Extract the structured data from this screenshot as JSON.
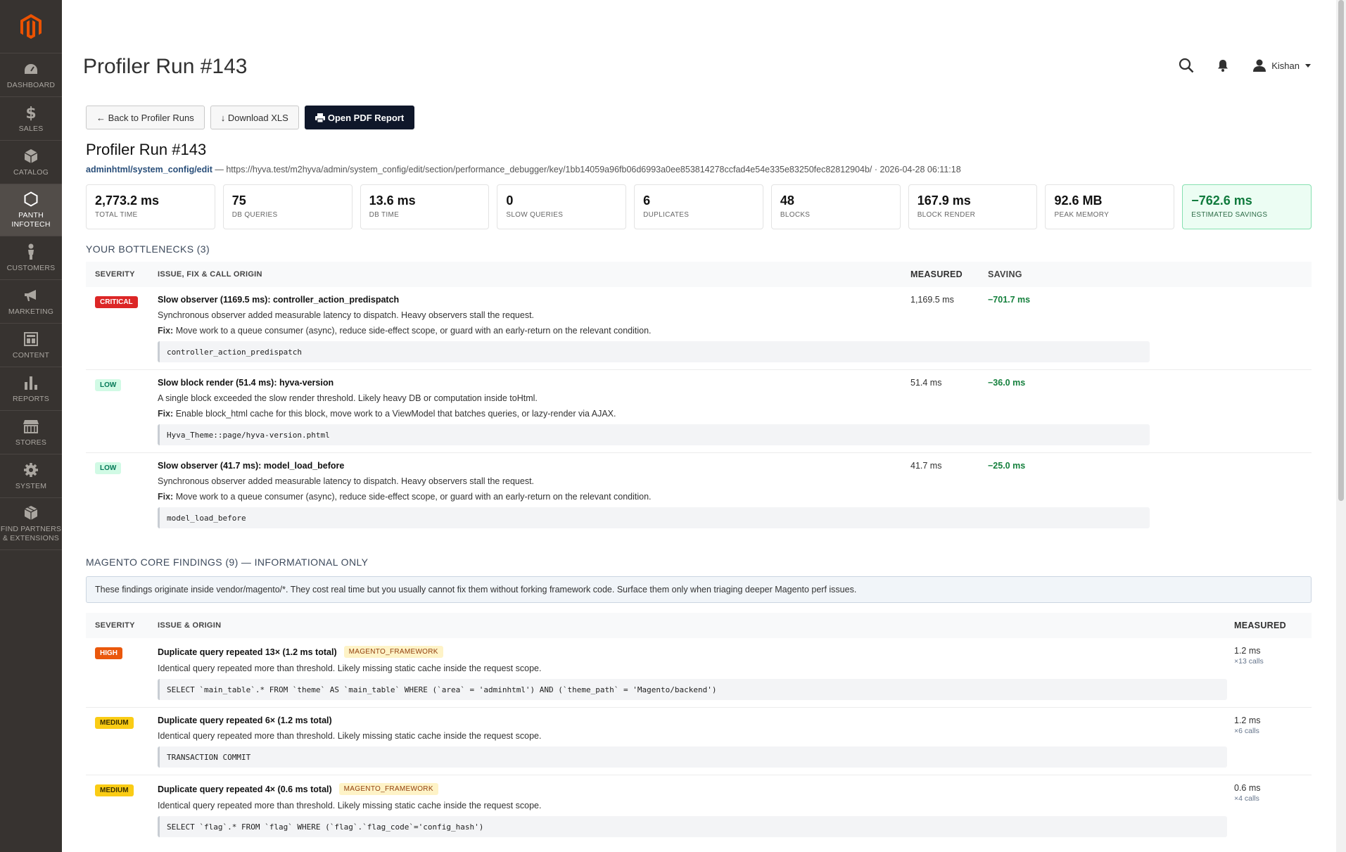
{
  "sidebar": {
    "items": [
      {
        "label": "DASHBOARD",
        "icon": "dashboard-icon"
      },
      {
        "label": "SALES",
        "icon": "dollar-icon"
      },
      {
        "label": "CATALOG",
        "icon": "box-icon"
      },
      {
        "label": "PANTH INFOTECH",
        "icon": "hexagon-icon"
      },
      {
        "label": "CUSTOMERS",
        "icon": "person-icon"
      },
      {
        "label": "MARKETING",
        "icon": "megaphone-icon"
      },
      {
        "label": "CONTENT",
        "icon": "layout-icon"
      },
      {
        "label": "REPORTS",
        "icon": "bar-chart-icon"
      },
      {
        "label": "STORES",
        "icon": "store-icon"
      },
      {
        "label": "SYSTEM",
        "icon": "gear-icon"
      },
      {
        "label": "FIND PARTNERS & EXTENSIONS",
        "icon": "cubes-icon"
      }
    ]
  },
  "header": {
    "title": "Profiler Run #143",
    "user": "Kishan"
  },
  "buttons": {
    "back": "← Back to Profiler Runs",
    "download": "↓ Download XLS",
    "pdf": "Open PDF Report"
  },
  "run": {
    "title": "Profiler Run #143",
    "path": "adminhtml/system_config/edit",
    "meta": " — https://hyva.test/m2hyva/admin/system_config/edit/section/performance_debugger/key/1bb14059a96fb06d6993a0ee853814278ccfad4e54e335e83250fec82812904b/ · 2026-04-28 06:11:18"
  },
  "stats": [
    {
      "value": "2,773.2 ms",
      "label": "TOTAL TIME"
    },
    {
      "value": "75",
      "label": "DB QUERIES"
    },
    {
      "value": "13.6 ms",
      "label": "DB TIME"
    },
    {
      "value": "0",
      "label": "SLOW QUERIES"
    },
    {
      "value": "6",
      "label": "DUPLICATES"
    },
    {
      "value": "48",
      "label": "BLOCKS"
    },
    {
      "value": "167.9 ms",
      "label": "BLOCK RENDER"
    },
    {
      "value": "92.6 MB",
      "label": "PEAK MEMORY"
    },
    {
      "value": "−762.6 ms",
      "label": "ESTIMATED SAVINGS"
    }
  ],
  "bottlenecks": {
    "heading": "YOUR BOTTLENECKS (3)",
    "columns": {
      "severity": "SEVERITY",
      "issue": "ISSUE, FIX & CALL ORIGIN",
      "measured": "MEASURED",
      "saving": "SAVING"
    },
    "rows": [
      {
        "severity": "CRITICAL",
        "title": "Slow observer (1169.5 ms): controller_action_predispatch",
        "desc": "Synchronous observer added measurable latency to dispatch. Heavy observers stall the request.",
        "fix_label": "Fix:",
        "fix": " Move work to a queue consumer (async), reduce side-effect scope, or guard with an early-return on the relevant condition.",
        "code": "controller_action_predispatch",
        "measured": "1,169.5 ms",
        "saving": "−701.7 ms"
      },
      {
        "severity": "LOW",
        "title": "Slow block render (51.4 ms): hyva-version",
        "desc": "A single block exceeded the slow render threshold. Likely heavy DB or computation inside toHtml.",
        "fix_label": "Fix:",
        "fix": " Enable block_html cache for this block, move work to a ViewModel that batches queries, or lazy-render via AJAX.",
        "code": "Hyva_Theme::page/hyva-version.phtml",
        "measured": "51.4 ms",
        "saving": "−36.0 ms"
      },
      {
        "severity": "LOW",
        "title": "Slow observer (41.7 ms): model_load_before",
        "desc": "Synchronous observer added measurable latency to dispatch. Heavy observers stall the request.",
        "fix_label": "Fix:",
        "fix": " Move work to a queue consumer (async), reduce side-effect scope, or guard with an early-return on the relevant condition.",
        "code": "model_load_before",
        "measured": "41.7 ms",
        "saving": "−25.0 ms"
      }
    ]
  },
  "core": {
    "heading": "MAGENTO CORE FINDINGS (9) — INFORMATIONAL ONLY",
    "note": "These findings originate inside vendor/magento/*. They cost real time but you usually cannot fix them without forking framework code. Surface them only when triaging deeper Magento perf issues.",
    "columns": {
      "severity": "SEVERITY",
      "issue": "ISSUE & ORIGIN",
      "measured": "MEASURED"
    },
    "rows": [
      {
        "severity": "HIGH",
        "title": "Duplicate query repeated 13× (1.2 ms total)",
        "tag": "MAGENTO_FRAMEWORK",
        "desc": "Identical query repeated more than threshold. Likely missing static cache inside the request scope.",
        "code": "SELECT `main_table`.* FROM `theme` AS `main_table` WHERE (`area` = 'adminhtml') AND (`theme_path` = 'Magento/backend')",
        "measured": "1.2 ms",
        "calls": "×13 calls"
      },
      {
        "severity": "MEDIUM",
        "title": "Duplicate query repeated 6× (1.2 ms total)",
        "tag": "",
        "desc": "Identical query repeated more than threshold. Likely missing static cache inside the request scope.",
        "code": "TRANSACTION COMMIT",
        "measured": "1.2 ms",
        "calls": "×6 calls"
      },
      {
        "severity": "MEDIUM",
        "title": "Duplicate query repeated 4× (0.6 ms total)",
        "tag": "MAGENTO_FRAMEWORK",
        "desc": "Identical query repeated more than threshold. Likely missing static cache inside the request scope.",
        "code": "SELECT `flag`.* FROM `flag` WHERE (`flag`.`flag_code`='config_hash')",
        "measured": "0.6 ms",
        "calls": "×4 calls"
      }
    ]
  },
  "colors": {
    "sidebar_bg": "#373330",
    "accent_orange": "#eb5202",
    "critical": "#dc2626",
    "saving_green": "#15803d"
  }
}
